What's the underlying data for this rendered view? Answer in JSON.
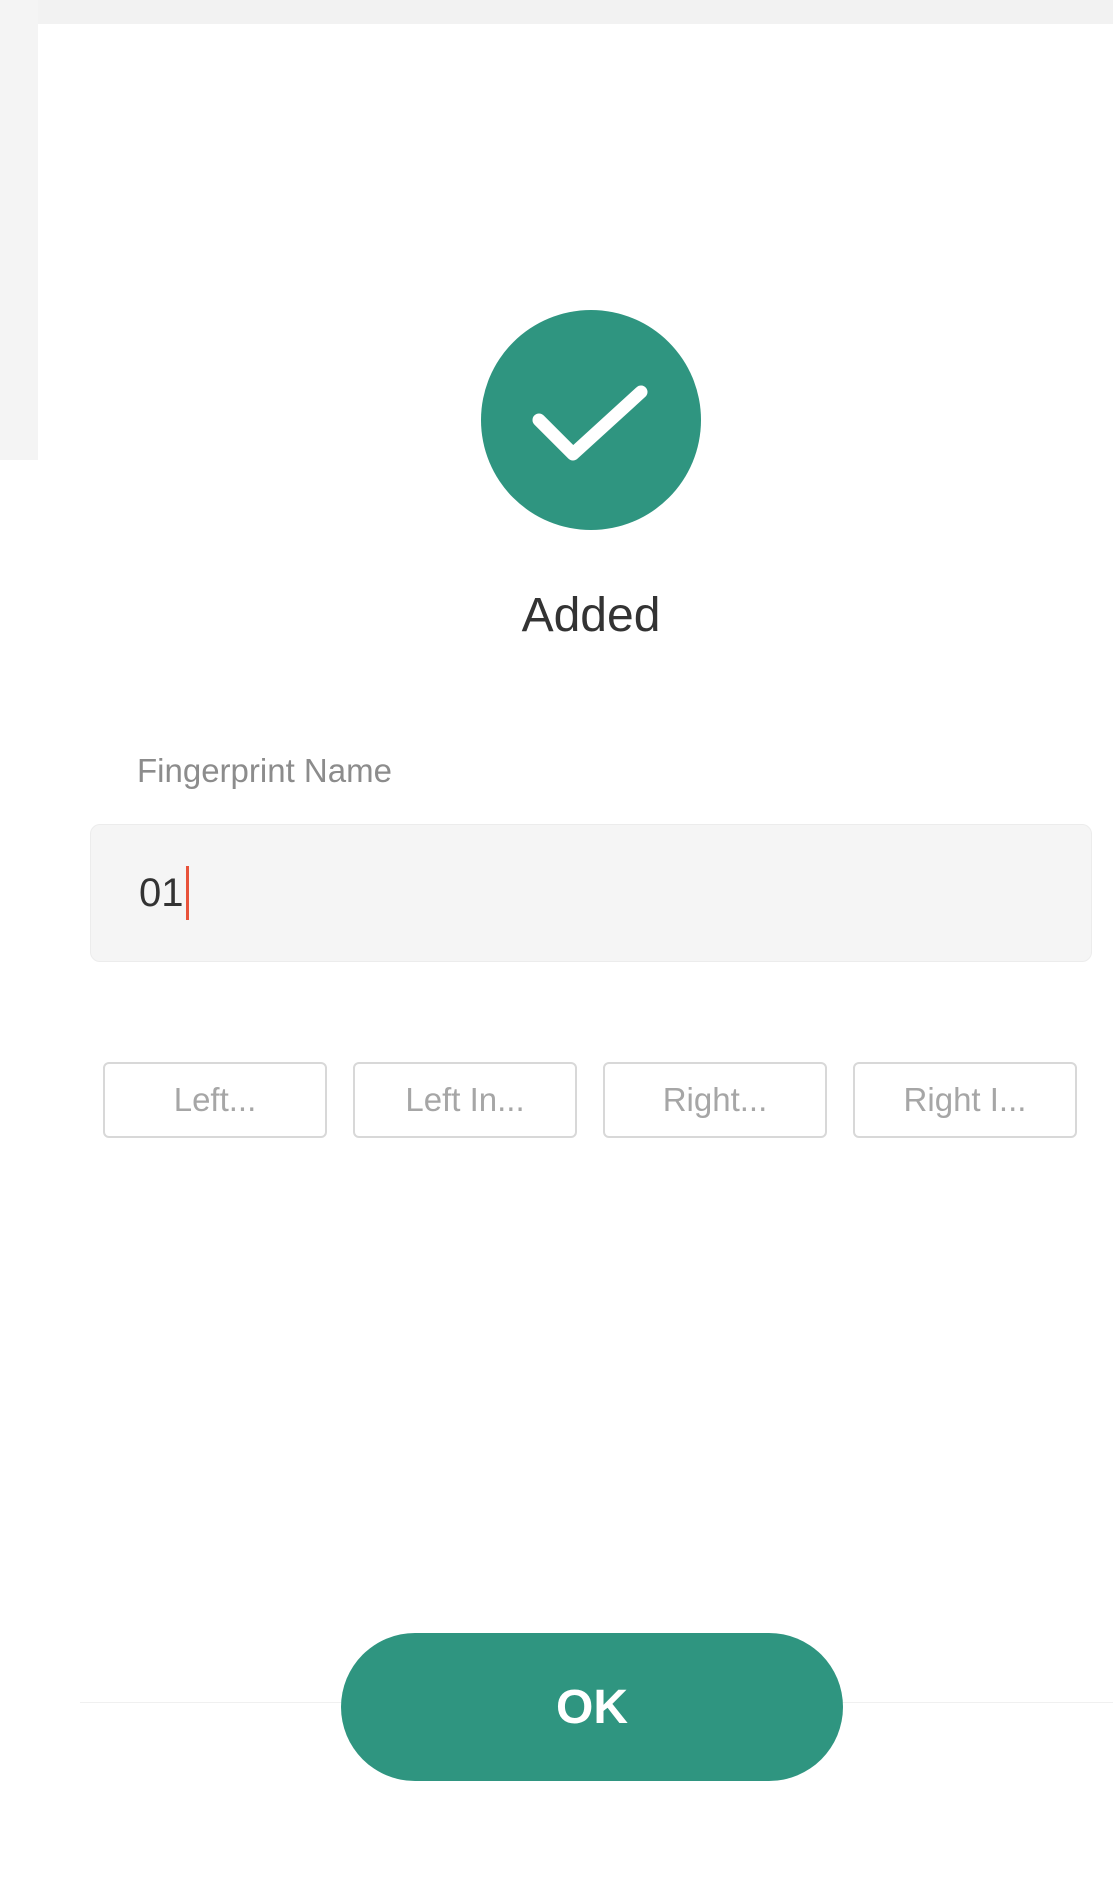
{
  "status": {
    "icon": "checkmark-icon",
    "label": "Added"
  },
  "fingerprint_name": {
    "label": "Fingerprint Name",
    "value": "01"
  },
  "finger_options": [
    {
      "label": "Left..."
    },
    {
      "label": "Left In..."
    },
    {
      "label": "Right..."
    },
    {
      "label": "Right I..."
    }
  ],
  "ok_button": {
    "label": "OK"
  },
  "colors": {
    "accent": "#2f9580",
    "caret": "#e8523a",
    "field_background": "#f5f5f5",
    "label_text": "#8c8c8c",
    "option_text": "#a6a6a6"
  }
}
